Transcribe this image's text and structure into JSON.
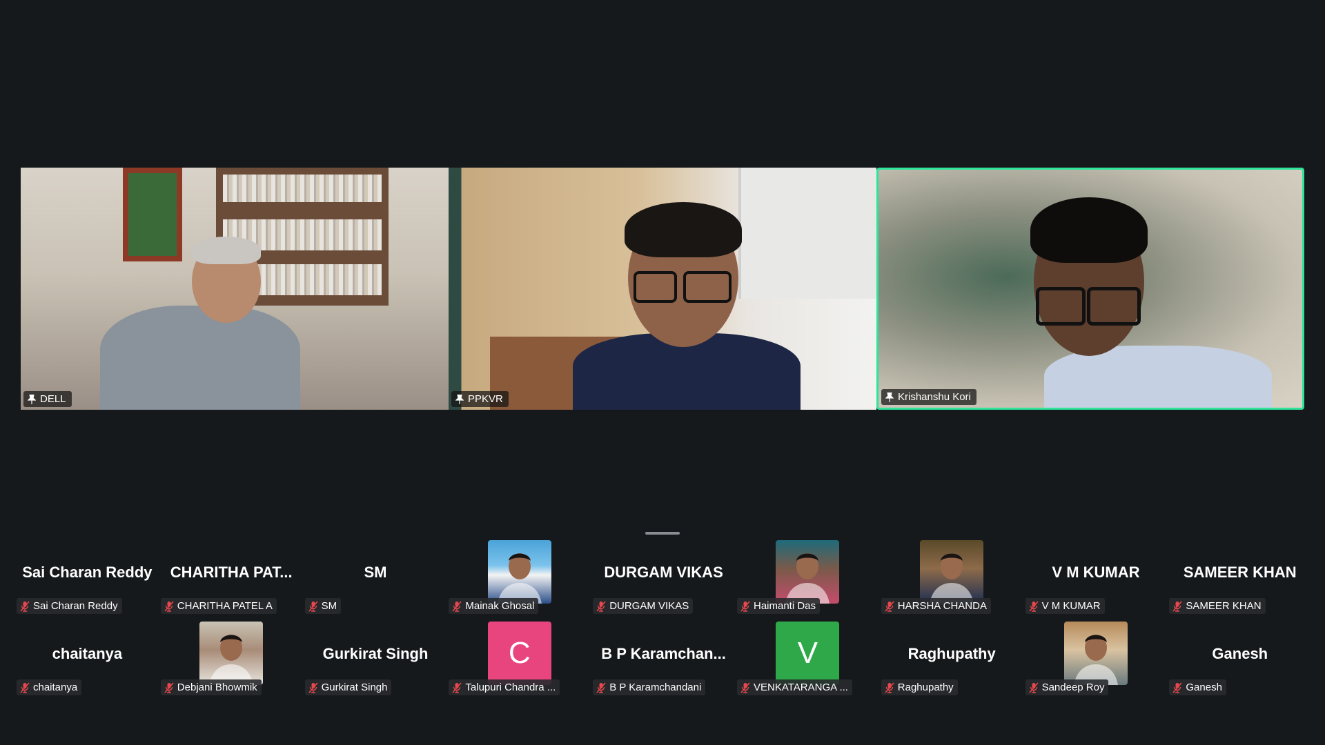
{
  "speakers": [
    {
      "name": "DELL",
      "pinned": true
    },
    {
      "name": "PPKVR",
      "pinned": true
    },
    {
      "name": "Krishanshu Kori",
      "pinned": true,
      "active_speaker": true
    }
  ],
  "gallery": [
    {
      "display": "Sai Charan Reddy",
      "label": "Sai Charan Reddy",
      "muted": true,
      "avatar": "none"
    },
    {
      "display": "CHARITHA  PAT...",
      "label": "CHARITHA PATEL A",
      "muted": true,
      "avatar": "none"
    },
    {
      "display": "SM",
      "label": "SM",
      "muted": true,
      "avatar": "none"
    },
    {
      "display": "",
      "label": "Mainak Ghosal",
      "muted": true,
      "avatar": "photo"
    },
    {
      "display": "DURGAM VIKAS",
      "label": "DURGAM VIKAS",
      "muted": true,
      "avatar": "none"
    },
    {
      "display": "",
      "label": "Haimanti Das",
      "muted": true,
      "avatar": "photo"
    },
    {
      "display": "",
      "label": "HARSHA CHANDA",
      "muted": true,
      "avatar": "photo"
    },
    {
      "display": "V M KUMAR",
      "label": "V M KUMAR",
      "muted": true,
      "avatar": "none"
    },
    {
      "display": "SAMEER KHAN",
      "label": "SAMEER KHAN",
      "muted": true,
      "avatar": "none"
    },
    {
      "display": "chaitanya",
      "label": "chaitanya",
      "muted": true,
      "avatar": "none"
    },
    {
      "display": "",
      "label": "Debjani Bhowmik",
      "muted": true,
      "avatar": "photo"
    },
    {
      "display": "Gurkirat Singh",
      "label": "Gurkirat Singh",
      "muted": true,
      "avatar": "none"
    },
    {
      "display": "",
      "label": "Talupuri Chandra ...",
      "muted": true,
      "avatar": "letter",
      "letter": "C",
      "color": "#e8457e"
    },
    {
      "display": "B  P  Karamchan...",
      "label": "B P Karamchandani",
      "muted": true,
      "avatar": "none"
    },
    {
      "display": "",
      "label": "VENKATARANGA ...",
      "muted": true,
      "avatar": "letter",
      "letter": "V",
      "color": "#2fa84a"
    },
    {
      "display": "Raghupathy",
      "label": "Raghupathy",
      "muted": true,
      "avatar": "none"
    },
    {
      "display": "",
      "label": "Sandeep Roy",
      "muted": true,
      "avatar": "photo"
    },
    {
      "display": "Ganesh",
      "label": "Ganesh",
      "muted": true,
      "avatar": "none"
    }
  ],
  "colors": {
    "background": "#16191c",
    "active_border": "#2ee49a",
    "muted_mic": "#e5484d"
  }
}
